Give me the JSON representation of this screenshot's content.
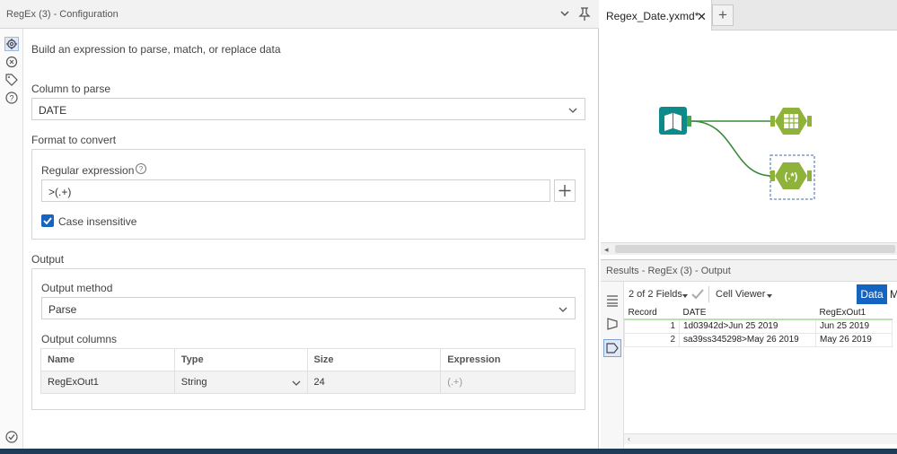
{
  "config": {
    "title": "RegEx (3) - Configuration",
    "description": "Build an expression to parse, match, or replace data",
    "column_label": "Column to parse",
    "column_value": "DATE",
    "format_label": "Format to convert",
    "regex_label": "Regular expression",
    "regex_value": ">(.+)",
    "case_label": "Case insensitive",
    "case_checked": true,
    "output_label": "Output",
    "method_label": "Output method",
    "method_value": "Parse",
    "columns_label": "Output columns",
    "columns_headers": [
      "Name",
      "Type",
      "Size",
      "Expression"
    ],
    "columns_row": {
      "name": "RegExOut1",
      "type": "String",
      "size": "24",
      "expression": "(.+)"
    }
  },
  "canvas": {
    "tab_label": "Regex_Date.yxmd*",
    "tab_close": "✕",
    "tab_add": "+",
    "tools": [
      "input-data-tool-icon",
      "browse-tool-icon",
      "regex-tool-icon"
    ],
    "regex_tool_text": "(.*)"
  },
  "results": {
    "title": "Results - RegEx (3) - Output",
    "fields_label": "2 of 2 Fields",
    "cell_viewer_label": "Cell Viewer",
    "data_label": "Data",
    "meta_label": "M",
    "headers": [
      "Record",
      "DATE",
      "RegExOut1"
    ],
    "rows": [
      {
        "record": "1",
        "date": "1d03942d>Jun 25 2019",
        "out": "Jun 25 2019"
      },
      {
        "record": "2",
        "date": "sa39ss345298>May 26 2019",
        "out": "May 26 2019"
      }
    ]
  },
  "colors": {
    "accent_blue": "#1565c0",
    "tool_teal": "#0e8a8a",
    "tool_olive": "#8fb33a",
    "connector_green": "#3a8a3a"
  }
}
